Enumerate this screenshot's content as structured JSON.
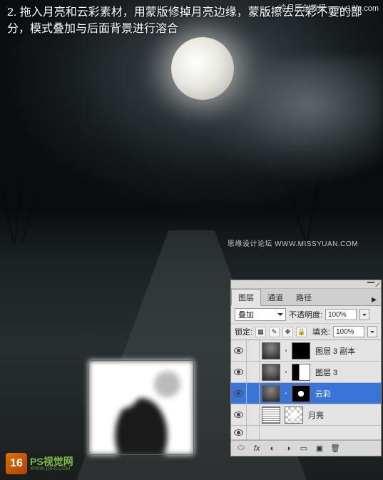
{
  "topCredit": "冷月原创教程 www.16fs.com",
  "instructions": "2. 拖入月亮和云彩素材，用蒙版修掉月亮边缘，蒙版擦去云彩不要的部分，模式叠加与后面背景进行溶合",
  "midWatermark": "思缘设计论坛   WWW.MISSYUAN.COM",
  "logo": {
    "badge": "16",
    "title": "PS视觉网",
    "url": "WWW.16FS.COM"
  },
  "panel": {
    "tabs": [
      "图层",
      "通道",
      "路径"
    ],
    "activeTab": 0,
    "blendMode": "叠加",
    "opacityLabel": "不透明度:",
    "opacityValue": "100%",
    "lockLabel": "锁定:",
    "fillLabel": "填充:",
    "fillValue": "100%",
    "layers": [
      {
        "name": "图层 3 副本",
        "visible": true,
        "selected": false,
        "hasMask": true
      },
      {
        "name": "图层 3",
        "visible": true,
        "selected": false,
        "hasMask": true
      },
      {
        "name": "云彩",
        "visible": true,
        "selected": true,
        "hasMask": true
      },
      {
        "name": "月亮",
        "visible": true,
        "selected": false,
        "hasMask": false
      }
    ]
  }
}
